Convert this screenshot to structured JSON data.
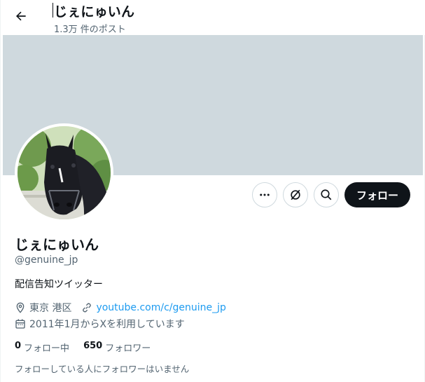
{
  "header": {
    "title": "じぇにゅいん",
    "post_count": "1.3万 件のポスト"
  },
  "colors": {
    "banner": "#cfd9de",
    "follow_button_bg": "#0f1419",
    "link": "#1d9bf0",
    "secondary_text": "#536471"
  },
  "profile": {
    "display_name": "じぇにゅいん",
    "handle": "@genuine_jp",
    "bio": "配信告知ツイッター",
    "location": "東京 港区",
    "website": "youtube.com/c/genuine_jp",
    "joined": "2011年1月からXを利用しています"
  },
  "actions": {
    "more_icon": "more-icon",
    "grok_icon": "grok-icon",
    "search_icon": "search-icon",
    "follow_label": "フォロー"
  },
  "stats": {
    "following_count": "0",
    "following_label": "フォロー中",
    "followers_count": "650",
    "followers_label": "フォロワー"
  },
  "mutual_note": "フォローしている人にフォロワーはいません"
}
